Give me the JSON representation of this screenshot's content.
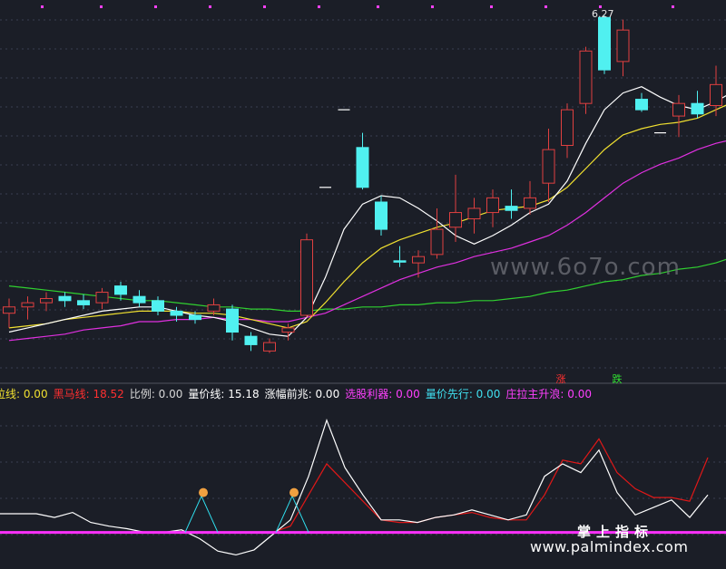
{
  "price_panel": {
    "high_label": "6.27",
    "tag_up": "涨",
    "tag_down": "跌",
    "colors": {
      "ma5": "#ffffff",
      "ma10": "#f0e030",
      "ma20": "#e030e0",
      "ma60": "#30d030",
      "up": "#e04040",
      "down": "#50f0f0",
      "background": "#1b1e27",
      "grid": "#3a3e50",
      "marker": "#ff40ff"
    }
  },
  "indicator_legend": {
    "items": [
      {
        "label": "拉线:",
        "value": "0.00",
        "color": "#f0e030"
      },
      {
        "label": "黑马线:",
        "value": "18.52",
        "color": "#ff3030"
      },
      {
        "label": "比例:",
        "value": "0.00",
        "color": "#d8d8d8"
      },
      {
        "label": "量价线:",
        "value": "15.18",
        "color": "#ffffff"
      },
      {
        "label": "涨幅前兆:",
        "value": "0.00",
        "color": "#ffffff"
      },
      {
        "label": "选股利器:",
        "value": "0.00",
        "color": "#ff40ff"
      },
      {
        "label": "量价先行:",
        "value": "0.00",
        "color": "#40e0f0"
      },
      {
        "label": "庄拉主升浪:",
        "value": "0.00",
        "color": "#ff40ff"
      }
    ]
  },
  "watermarks": {
    "site1": "www.6o7o.com",
    "brand": "掌上指标",
    "site2": "www.palmindex.com"
  },
  "chart_data": {
    "type": "candlestick",
    "title": "",
    "candles": [
      {
        "o": 4.85,
        "h": 4.92,
        "l": 4.78,
        "c": 4.88,
        "dir": "up"
      },
      {
        "o": 4.88,
        "h": 4.93,
        "l": 4.82,
        "c": 4.9,
        "dir": "up"
      },
      {
        "o": 4.9,
        "h": 4.95,
        "l": 4.86,
        "c": 4.92,
        "dir": "up"
      },
      {
        "o": 4.93,
        "h": 4.95,
        "l": 4.88,
        "c": 4.91,
        "dir": "down"
      },
      {
        "o": 4.91,
        "h": 4.94,
        "l": 4.87,
        "c": 4.89,
        "dir": "down"
      },
      {
        "o": 4.9,
        "h": 4.97,
        "l": 4.87,
        "c": 4.95,
        "dir": "up"
      },
      {
        "o": 4.98,
        "h": 5.0,
        "l": 4.91,
        "c": 4.94,
        "dir": "down"
      },
      {
        "o": 4.93,
        "h": 4.96,
        "l": 4.88,
        "c": 4.9,
        "dir": "down"
      },
      {
        "o": 4.91,
        "h": 4.93,
        "l": 4.84,
        "c": 4.86,
        "dir": "down"
      },
      {
        "o": 4.86,
        "h": 4.88,
        "l": 4.81,
        "c": 4.84,
        "dir": "down"
      },
      {
        "o": 4.84,
        "h": 4.86,
        "l": 4.8,
        "c": 4.82,
        "dir": "down"
      },
      {
        "o": 4.86,
        "h": 4.92,
        "l": 4.84,
        "c": 4.89,
        "dir": "up"
      },
      {
        "o": 4.87,
        "h": 4.89,
        "l": 4.72,
        "c": 4.76,
        "dir": "down"
      },
      {
        "o": 4.74,
        "h": 4.76,
        "l": 4.67,
        "c": 4.7,
        "dir": "down"
      },
      {
        "o": 4.67,
        "h": 4.73,
        "l": 4.66,
        "c": 4.71,
        "dir": "up"
      },
      {
        "o": 4.76,
        "h": 4.8,
        "l": 4.72,
        "c": 4.78,
        "dir": "up"
      },
      {
        "o": 4.84,
        "h": 5.23,
        "l": 4.83,
        "c": 5.2,
        "dir": "up"
      },
      {
        "o": 5.45,
        "h": 5.45,
        "l": 5.45,
        "c": 5.45,
        "dir": "flat"
      },
      {
        "o": 5.82,
        "h": 5.82,
        "l": 5.82,
        "c": 5.82,
        "dir": "flat"
      },
      {
        "o": 5.64,
        "h": 5.71,
        "l": 5.44,
        "c": 5.45,
        "dir": "down"
      },
      {
        "o": 5.38,
        "h": 5.41,
        "l": 5.22,
        "c": 5.25,
        "dir": "down"
      },
      {
        "o": 5.1,
        "h": 5.17,
        "l": 5.07,
        "c": 5.1,
        "dir": "down"
      },
      {
        "o": 5.09,
        "h": 5.15,
        "l": 5.02,
        "c": 5.12,
        "dir": "up"
      },
      {
        "o": 5.13,
        "h": 5.35,
        "l": 5.11,
        "c": 5.25,
        "dir": "up"
      },
      {
        "o": 5.26,
        "h": 5.51,
        "l": 5.19,
        "c": 5.33,
        "dir": "up"
      },
      {
        "o": 5.3,
        "h": 5.4,
        "l": 5.23,
        "c": 5.35,
        "dir": "up"
      },
      {
        "o": 5.33,
        "h": 5.44,
        "l": 5.26,
        "c": 5.4,
        "dir": "up"
      },
      {
        "o": 5.36,
        "h": 5.44,
        "l": 5.3,
        "c": 5.34,
        "dir": "down"
      },
      {
        "o": 5.35,
        "h": 5.48,
        "l": 5.32,
        "c": 5.4,
        "dir": "up"
      },
      {
        "o": 5.47,
        "h": 5.73,
        "l": 5.38,
        "c": 5.63,
        "dir": "up"
      },
      {
        "o": 5.65,
        "h": 5.85,
        "l": 5.59,
        "c": 5.82,
        "dir": "up"
      },
      {
        "o": 5.85,
        "h": 6.12,
        "l": 5.8,
        "c": 6.1,
        "dir": "up"
      },
      {
        "o": 6.26,
        "h": 6.27,
        "l": 5.99,
        "c": 6.01,
        "dir": "down"
      },
      {
        "o": 6.05,
        "h": 6.25,
        "l": 5.98,
        "c": 6.2,
        "dir": "up"
      },
      {
        "o": 5.87,
        "h": 5.9,
        "l": 5.81,
        "c": 5.82,
        "dir": "down"
      },
      {
        "o": 5.71,
        "h": 5.71,
        "l": 5.71,
        "c": 5.71,
        "dir": "flat"
      },
      {
        "o": 5.79,
        "h": 5.89,
        "l": 5.69,
        "c": 5.85,
        "dir": "up"
      },
      {
        "o": 5.85,
        "h": 5.91,
        "l": 5.78,
        "c": 5.8,
        "dir": "down"
      },
      {
        "o": 5.84,
        "h": 6.03,
        "l": 5.79,
        "c": 5.94,
        "dir": "up"
      },
      {
        "o": 5.9,
        "h": 6.21,
        "l": 5.86,
        "c": 6.19,
        "dir": "up"
      }
    ],
    "ma5": [
      4.76,
      4.78,
      4.8,
      4.82,
      4.84,
      4.86,
      4.87,
      4.88,
      4.88,
      4.86,
      4.84,
      4.83,
      4.81,
      4.78,
      4.75,
      4.74,
      4.83,
      5.02,
      5.25,
      5.37,
      5.41,
      5.4,
      5.35,
      5.29,
      5.22,
      5.18,
      5.22,
      5.27,
      5.33,
      5.37,
      5.48,
      5.66,
      5.82,
      5.9,
      5.93,
      5.88,
      5.84,
      5.82,
      5.86,
      5.91
    ],
    "ma10": [
      4.78,
      4.79,
      4.8,
      4.82,
      4.83,
      4.84,
      4.85,
      4.86,
      4.86,
      4.86,
      4.85,
      4.85,
      4.84,
      4.82,
      4.8,
      4.78,
      4.81,
      4.9,
      5.0,
      5.09,
      5.16,
      5.2,
      5.23,
      5.26,
      5.28,
      5.31,
      5.34,
      5.35,
      5.36,
      5.39,
      5.45,
      5.54,
      5.63,
      5.7,
      5.73,
      5.75,
      5.76,
      5.78,
      5.82,
      5.86
    ],
    "ma20": [
      4.72,
      4.73,
      4.74,
      4.75,
      4.77,
      4.78,
      4.79,
      4.81,
      4.81,
      4.82,
      4.82,
      4.83,
      4.82,
      4.82,
      4.81,
      4.81,
      4.83,
      4.85,
      4.89,
      4.93,
      4.97,
      5.01,
      5.04,
      5.07,
      5.09,
      5.12,
      5.14,
      5.16,
      5.19,
      5.22,
      5.27,
      5.33,
      5.4,
      5.47,
      5.52,
      5.56,
      5.59,
      5.63,
      5.66,
      5.68
    ],
    "ma60": [
      4.98,
      4.97,
      4.96,
      4.95,
      4.94,
      4.93,
      4.92,
      4.91,
      4.91,
      4.9,
      4.89,
      4.88,
      4.88,
      4.87,
      4.87,
      4.86,
      4.86,
      4.87,
      4.87,
      4.88,
      4.88,
      4.89,
      4.89,
      4.9,
      4.9,
      4.91,
      4.91,
      4.92,
      4.93,
      4.95,
      4.96,
      4.98,
      5.0,
      5.01,
      5.03,
      5.04,
      5.06,
      5.07,
      5.09,
      5.12
    ],
    "ylim": [
      4.65,
      6.3
    ],
    "indicator": {
      "ylim": [
        -25,
        100
      ],
      "white": [
        15,
        15,
        15,
        12,
        16,
        8,
        5,
        3,
        0,
        0,
        2,
        -5,
        -15,
        -18,
        -14,
        -2,
        10,
        45,
        90,
        52,
        30,
        10,
        10,
        8,
        12,
        14,
        18,
        14,
        10,
        14,
        45,
        55,
        48,
        66,
        32,
        14,
        20,
        26,
        12,
        30
      ],
      "red": [
        0,
        0,
        0,
        0,
        0,
        0,
        0,
        0,
        0,
        0,
        0,
        0,
        0,
        0,
        0,
        0,
        5,
        30,
        55,
        40,
        25,
        10,
        8,
        8,
        12,
        14,
        16,
        12,
        10,
        10,
        30,
        58,
        55,
        75,
        48,
        35,
        28,
        28,
        25,
        60
      ],
      "magenta_baseline": 0,
      "signals": [
        10,
        15
      ]
    }
  }
}
